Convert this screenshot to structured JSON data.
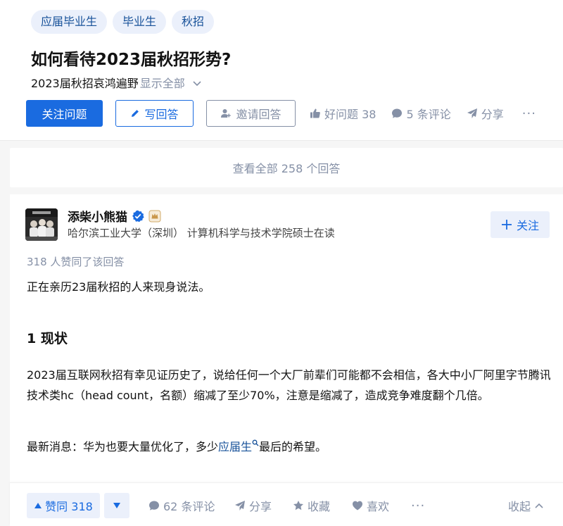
{
  "question": {
    "tags": [
      "应届毕业生",
      "毕业生",
      "秋招"
    ],
    "title": "如何看待2023届秋招形势?",
    "detail": "2023届秋招哀鸿遍野",
    "show_all": "显示全部",
    "follow_label": "关注问题",
    "write_label": "写回答",
    "invite_label": "邀请回答",
    "good_question": "好问题 38",
    "comments": "5 条评论",
    "share": "分享",
    "more": "···"
  },
  "view_all": "查看全部 258 个回答",
  "answer": {
    "author": {
      "name": "添柴小熊猫",
      "bio": "哈尔滨工业大学（深圳） 计算机科学与技术学院硕士在读",
      "follow_label": "关注"
    },
    "votes_text": "318 人赞同了该回答",
    "intro": "正在亲历23届秋招的人来现身说法。",
    "heading": "1 现状",
    "paragraph": "2023届互联网秋招有幸见证历史了，说给任何一个大厂前辈们可能都不会相信，各大中小厂阿里字节腾讯技术类hc（head count，名额）缩减了至少70%，注意是缩减了，造成竞争难度翻个几倍。",
    "news_prefix": "最新消息：华为也要大量优化了，多少",
    "news_link": "应届生",
    "news_suffix": "最后的希望。"
  },
  "action_bar": {
    "upvote": "赞同 318",
    "comments": "62 条评论",
    "share": "分享",
    "favorite": "收藏",
    "like": "喜欢",
    "more": "···",
    "collapse": "收起"
  },
  "colors": {
    "primary": "#1a6be0",
    "tag_bg": "#ebf0fb",
    "meta_gray": "#8590a6",
    "link": "#175199"
  }
}
